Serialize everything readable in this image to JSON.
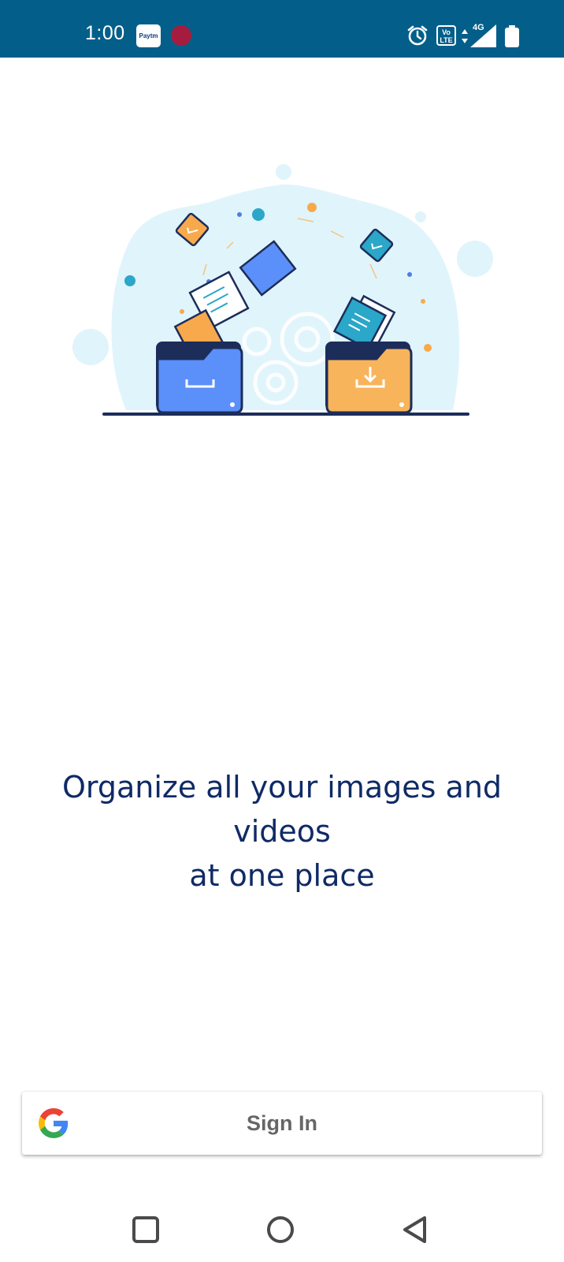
{
  "status_bar": {
    "time": "1:00",
    "paytm_label": "Paytm",
    "volte_label": "Vo LTE",
    "network_type": "4G",
    "background_color": "#035f8a"
  },
  "main": {
    "tagline_line1": "Organize all your images and videos",
    "tagline_line2": "at one place",
    "tagline_color": "#0f2a66"
  },
  "signin": {
    "label": "Sign In",
    "icon": "google-icon"
  },
  "nav_bar": {
    "recents": "square-icon",
    "home": "circle-icon",
    "back": "triangle-back-icon"
  }
}
